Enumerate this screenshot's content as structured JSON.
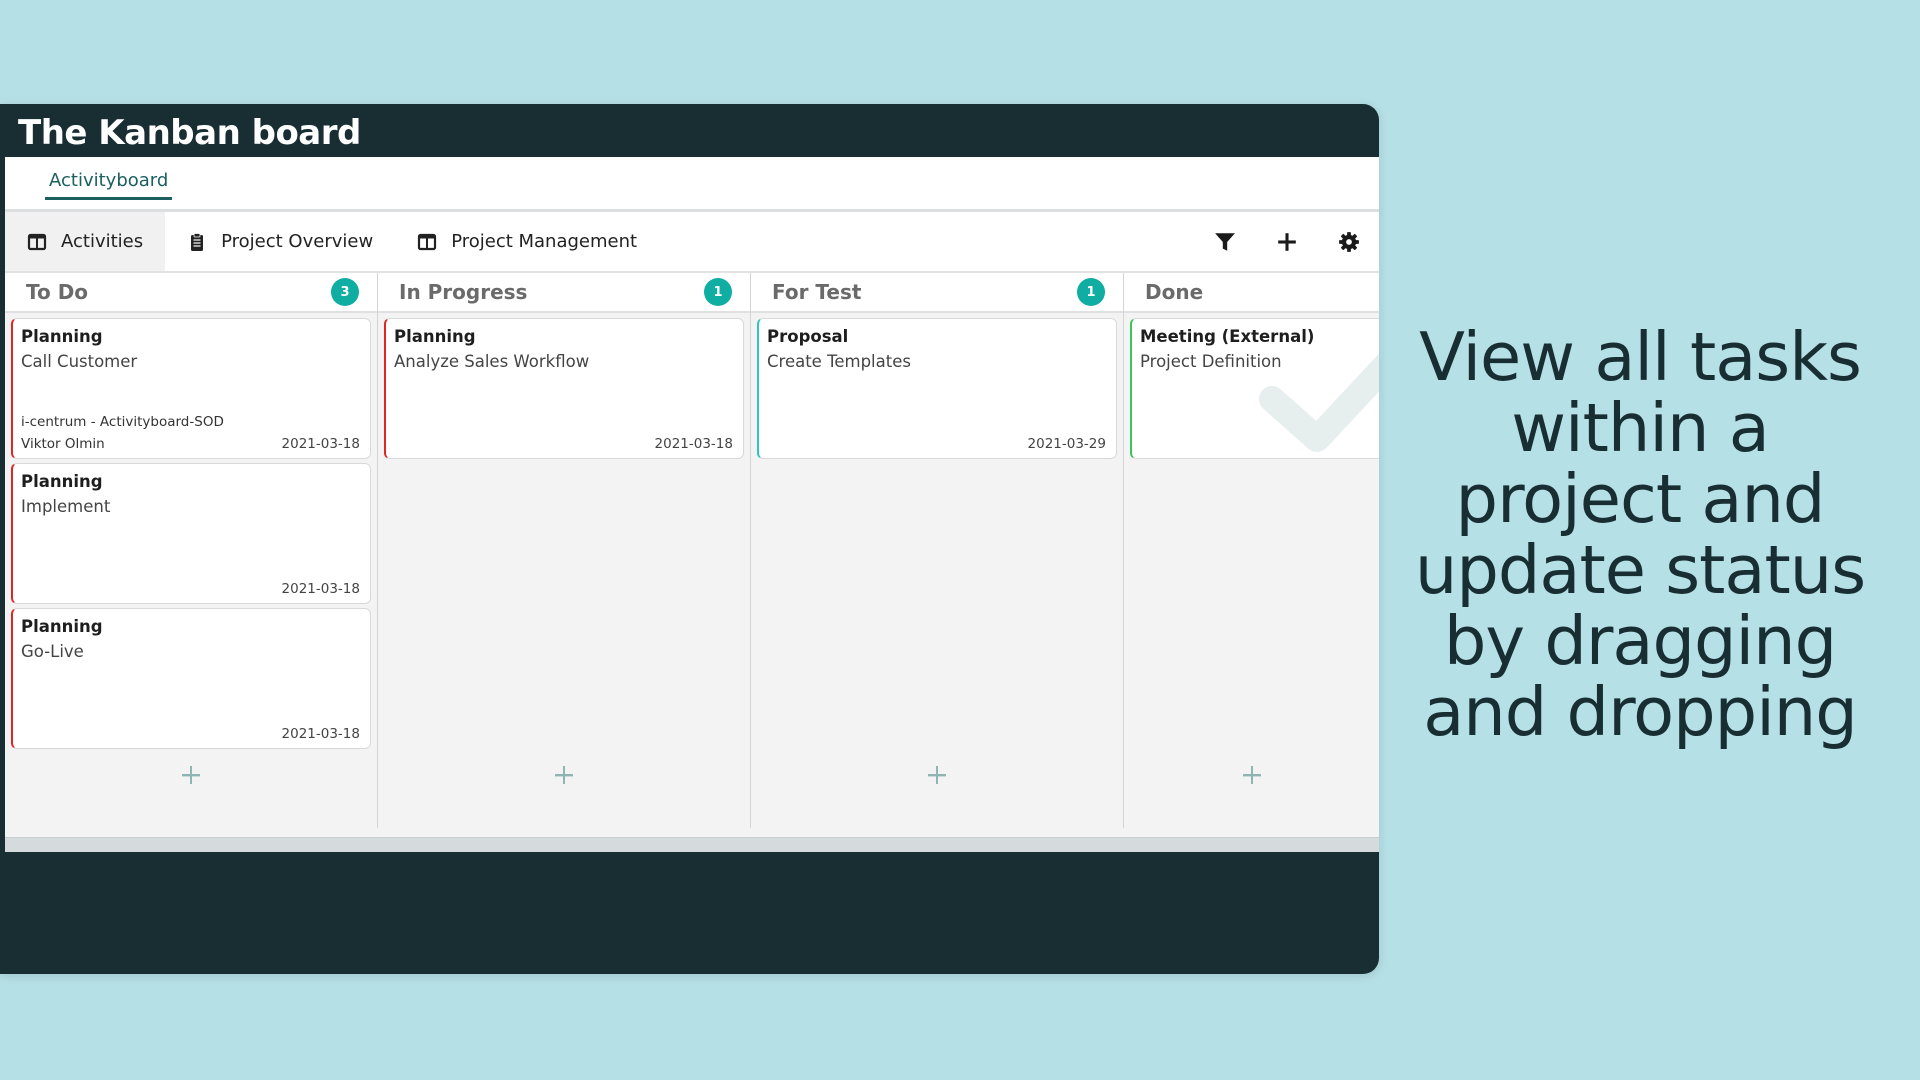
{
  "window": {
    "title": "The Kanban board"
  },
  "tabbar": {
    "active_tab": "Activityboard"
  },
  "toolbar": {
    "views": [
      {
        "label": "Activities",
        "icon": "columns-icon",
        "active": true
      },
      {
        "label": "Project Overview",
        "icon": "clipboard-list-icon",
        "active": false
      },
      {
        "label": "Project Management",
        "icon": "columns-icon",
        "active": false
      }
    ],
    "actions": [
      "filter-icon",
      "plus-icon",
      "gear-icon"
    ]
  },
  "colors": {
    "header_bg": "#182e33",
    "badge": "#10ada3",
    "card_red": "#e02525",
    "card_cyan": "#2ec4c4",
    "card_green": "#3cc35c",
    "tab_accent": "#1b5f5f",
    "page_bg": "#b5e0e6"
  },
  "columns": [
    {
      "title": "To Do",
      "count": "3",
      "cards": [
        {
          "type": "Planning",
          "title": "Call Customer",
          "project": "i-centrum - Activityboard-SOD",
          "assignee": "Viktor Olmin",
          "date": "2021-03-18",
          "accent": "red"
        },
        {
          "type": "Planning",
          "title": "Implement",
          "project": "",
          "assignee": "",
          "date": "2021-03-18",
          "accent": "red"
        },
        {
          "type": "Planning",
          "title": "Go-Live",
          "project": "",
          "assignee": "",
          "date": "2021-03-18",
          "accent": "red"
        }
      ]
    },
    {
      "title": "In Progress",
      "count": "1",
      "cards": [
        {
          "type": "Planning",
          "title": "Analyze Sales Workflow",
          "project": "",
          "assignee": "",
          "date": "2021-03-18",
          "accent": "red"
        }
      ]
    },
    {
      "title": "For Test",
      "count": "1",
      "cards": [
        {
          "type": "Proposal",
          "title": "Create Templates",
          "project": "",
          "assignee": "",
          "date": "2021-03-29",
          "accent": "cyan"
        }
      ]
    },
    {
      "title": "Done",
      "count": "",
      "cards": [
        {
          "type": "Meeting (External)",
          "title": "Project Definition",
          "project": "",
          "assignee": "",
          "date": "",
          "accent": "green"
        }
      ]
    }
  ],
  "tagline": "View all tasks within a project and update status by dragging and dropping"
}
